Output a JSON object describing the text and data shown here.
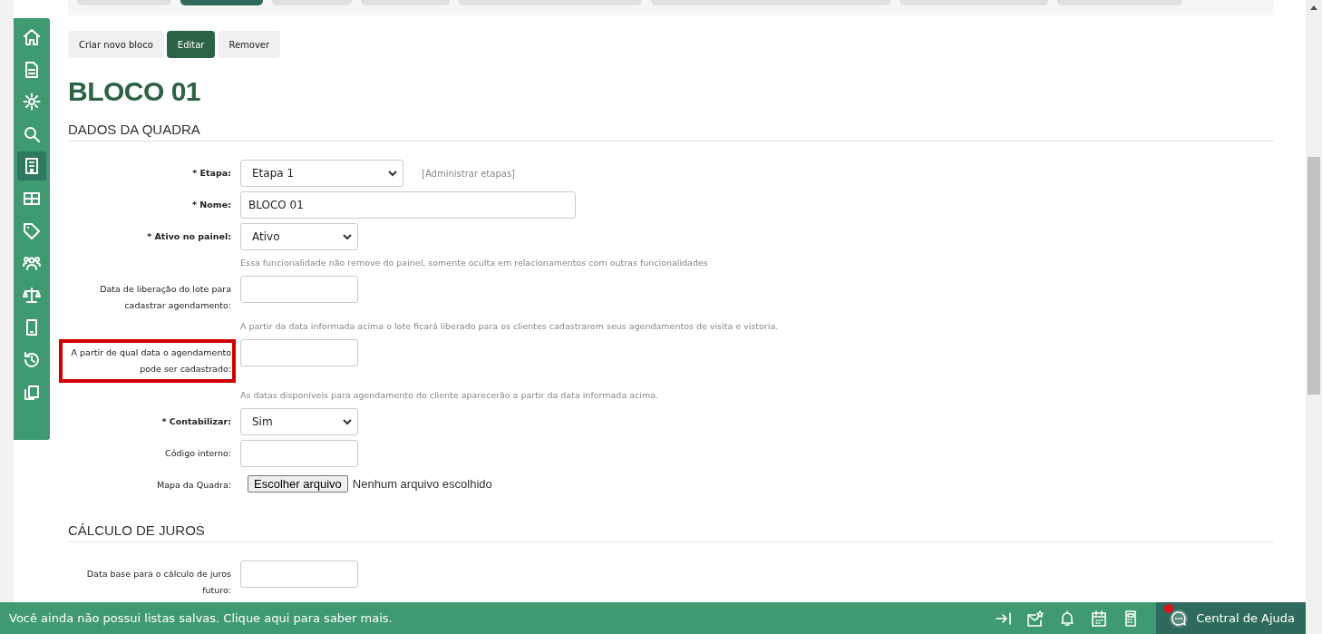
{
  "top_tabs": [
    {
      "selected": false
    },
    {
      "selected": true
    },
    {
      "selected": false
    },
    {
      "selected": false
    },
    {
      "selected": false
    },
    {
      "selected": false
    },
    {
      "selected": false
    },
    {
      "selected": false
    }
  ],
  "sidebar": {
    "items": [
      {
        "selected": false
      },
      {
        "selected": false
      },
      {
        "selected": false
      },
      {
        "selected": false
      },
      {
        "selected": true
      },
      {
        "selected": false
      },
      {
        "selected": false
      },
      {
        "selected": false
      },
      {
        "selected": false
      },
      {
        "selected": false
      },
      {
        "selected": false
      },
      {
        "selected": false
      }
    ]
  },
  "actions": [
    {
      "label": "Criar novo bloco",
      "selected": false
    },
    {
      "label": "Editar",
      "selected": true
    },
    {
      "label": "Remover",
      "selected": false
    }
  ],
  "title": "BLOCO 01",
  "sections": [
    {
      "heading": "DADOS DA QUADRA",
      "fields": [
        {
          "kind": "select",
          "marker": "*",
          "label": "Etapa:",
          "required": true,
          "value": "Etapa 1",
          "link": "[Administrar etapas]"
        },
        {
          "kind": "text",
          "marker": "*",
          "label": "Nome:",
          "required": true,
          "value": "BLOCO 01"
        },
        {
          "kind": "select",
          "marker": "*",
          "label": "Ativo no painel:",
          "required": true,
          "value": "Ativo",
          "hint": "Essa funcionalidade não remove do painel, somente oculta em relacionamentos com outras funcionalidades"
        },
        {
          "kind": "text",
          "label": "Data de liberação do lote para cadastrar agendamento:",
          "required": false,
          "hint": "A partir da data informada acima o lote ficará liberado para os clientes cadastrarem seus agendamentos de visita e vistoria."
        },
        {
          "kind": "text",
          "label": "A partir de qual data o agendamento pode ser cadastrado:",
          "required": false,
          "highlighted": true,
          "hint": "As datas disponíveis para agendamento do cliente aparecerão a partir da data informada acima."
        },
        {
          "kind": "select",
          "marker": "*",
          "label": "Contabilizar:",
          "required": true,
          "value": "Sim"
        },
        {
          "kind": "text",
          "label": "Código interno:",
          "required": false
        },
        {
          "kind": "file",
          "label": "Mapa da Quadra:",
          "required": false,
          "button": "Escolher arquivo",
          "value": "Nenhum arquivo escolhido"
        }
      ]
    },
    {
      "heading": "CÁLCULO DE JUROS",
      "fields": [
        {
          "kind": "text",
          "label": "Data base para o cálculo de juros futuro:",
          "required": false
        }
      ]
    }
  ],
  "bottom_bar": {
    "message": "Você ainda não possui listas salvas. Clique aqui para saber mais.",
    "help": {
      "label": "Central de Ajuda",
      "notification": true
    }
  }
}
